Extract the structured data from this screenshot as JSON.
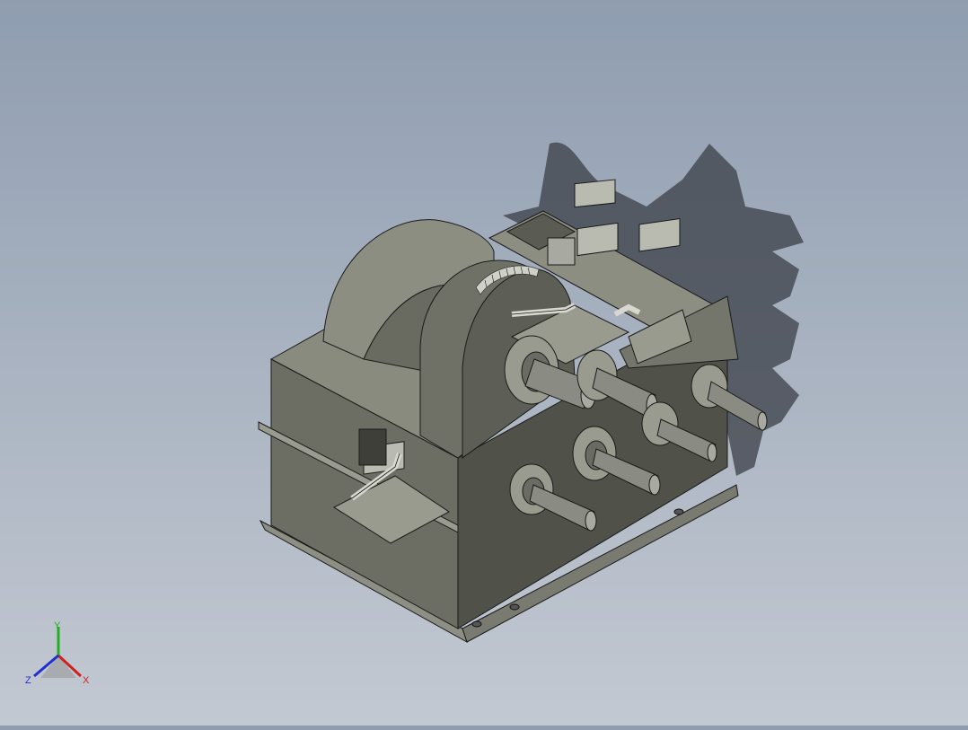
{
  "viewport": {
    "background_top": "#8f9db0",
    "background_bottom": "#c3c9d2"
  },
  "model": {
    "body_color": "#6e6f64",
    "body_dark": "#56574e",
    "body_light": "#8d8e82",
    "shadow_color": "#3a3d45",
    "shaft_color": "#9a9a92",
    "edge_color": "#1a1a1a"
  },
  "triad": {
    "x_label": "X",
    "y_label": "Y",
    "z_label": "Z",
    "x_color": "#d02020",
    "y_color": "#20b020",
    "z_color": "#2030d0"
  }
}
